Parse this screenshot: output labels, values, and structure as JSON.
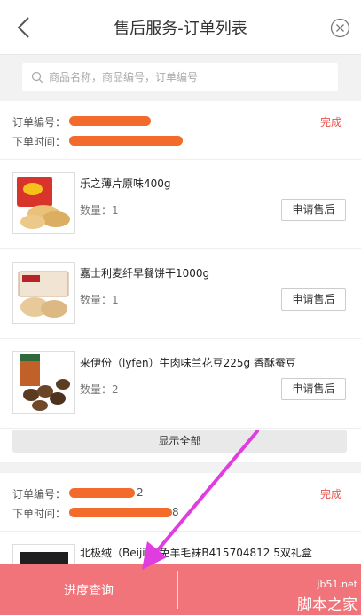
{
  "header": {
    "title": "售后服务-订单列表"
  },
  "search": {
    "placeholder": "商品名称，商品编号，订单编号"
  },
  "orders": [
    {
      "order_no_label": "订单编号：",
      "order_time_label": "下单时间：",
      "status": "完成",
      "products": [
        {
          "name": "乐之薄片原味400g",
          "qty_label": "数量：1",
          "apply_label": "申请售后"
        },
        {
          "name": "嘉士利麦纤早餐饼干1000g",
          "qty_label": "数量：1",
          "apply_label": "申请售后"
        },
        {
          "name": "来伊份（lyfen）牛肉味兰花豆225g 香酥蚕豆",
          "qty_label": "数量：2",
          "apply_label": "申请售后"
        }
      ],
      "show_all_label": "显示全部"
    },
    {
      "order_no_label": "订单编号：",
      "order_no_partial": "2",
      "order_time_label": "下单时间：",
      "order_time_partial": "8",
      "status": "完成",
      "products": [
        {
          "name": "北极绒（Beiji   ）免羊毛袜B415704812 5双礼盒"
        }
      ]
    }
  ],
  "bottom_bar": {
    "progress_label": "进度查询"
  },
  "watermark": {
    "site": "jb51.net",
    "logo": "脚本之家"
  },
  "colors": {
    "status": "#e8554e",
    "bottom_bar": "#f0747a",
    "redaction": "#f26b2a",
    "arrow": "#e03ce0"
  }
}
